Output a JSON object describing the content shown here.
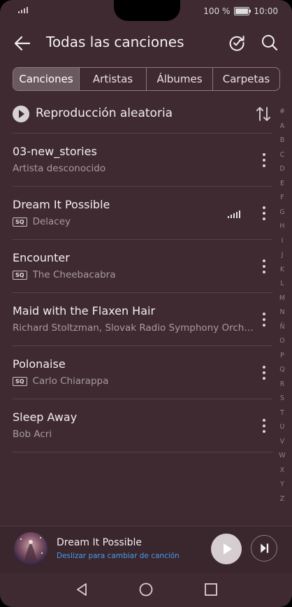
{
  "status": {
    "battery_pct": "100 %",
    "time": "10:00"
  },
  "toolbar": {
    "title": "Todas las canciones"
  },
  "tabs": [
    {
      "label": "Canciones",
      "active": true
    },
    {
      "label": "Artistas",
      "active": false
    },
    {
      "label": "Álbumes",
      "active": false
    },
    {
      "label": "Carpetas",
      "active": false
    }
  ],
  "shuffle": {
    "label": "Reproducción aleatoria"
  },
  "songs": [
    {
      "title": "03-new_stories",
      "artist": "Artista desconocido",
      "sq": false,
      "playing": false
    },
    {
      "title": "Dream It Possible",
      "artist": "Delacey",
      "sq": true,
      "playing": true
    },
    {
      "title": "Encounter",
      "artist": "The Cheebacabra",
      "sq": true,
      "playing": false
    },
    {
      "title": "Maid with the Flaxen Hair",
      "artist": "Richard Stoltzman, Slovak Radio Symphony Orche...",
      "sq": false,
      "playing": false
    },
    {
      "title": "Polonaise",
      "artist": "Carlo Chiarappa",
      "sq": true,
      "playing": false
    },
    {
      "title": "Sleep Away",
      "artist": "Bob Acri",
      "sq": false,
      "playing": false
    }
  ],
  "sq_badge": "SQ",
  "alphabet": [
    "#",
    "A",
    "B",
    "C",
    "D",
    "E",
    "F",
    "G",
    "H",
    "I",
    "J",
    "K",
    "L",
    "M",
    "N",
    "Ñ",
    "O",
    "P",
    "Q",
    "R",
    "S",
    "T",
    "U",
    "V",
    "W",
    "X",
    "Y",
    "Z"
  ],
  "now_playing": {
    "title": "Dream It Possible",
    "hint": "Deslizar para cambiar de canción"
  },
  "colors": {
    "background": "#3f2a32",
    "accent": "#4a9be8"
  }
}
